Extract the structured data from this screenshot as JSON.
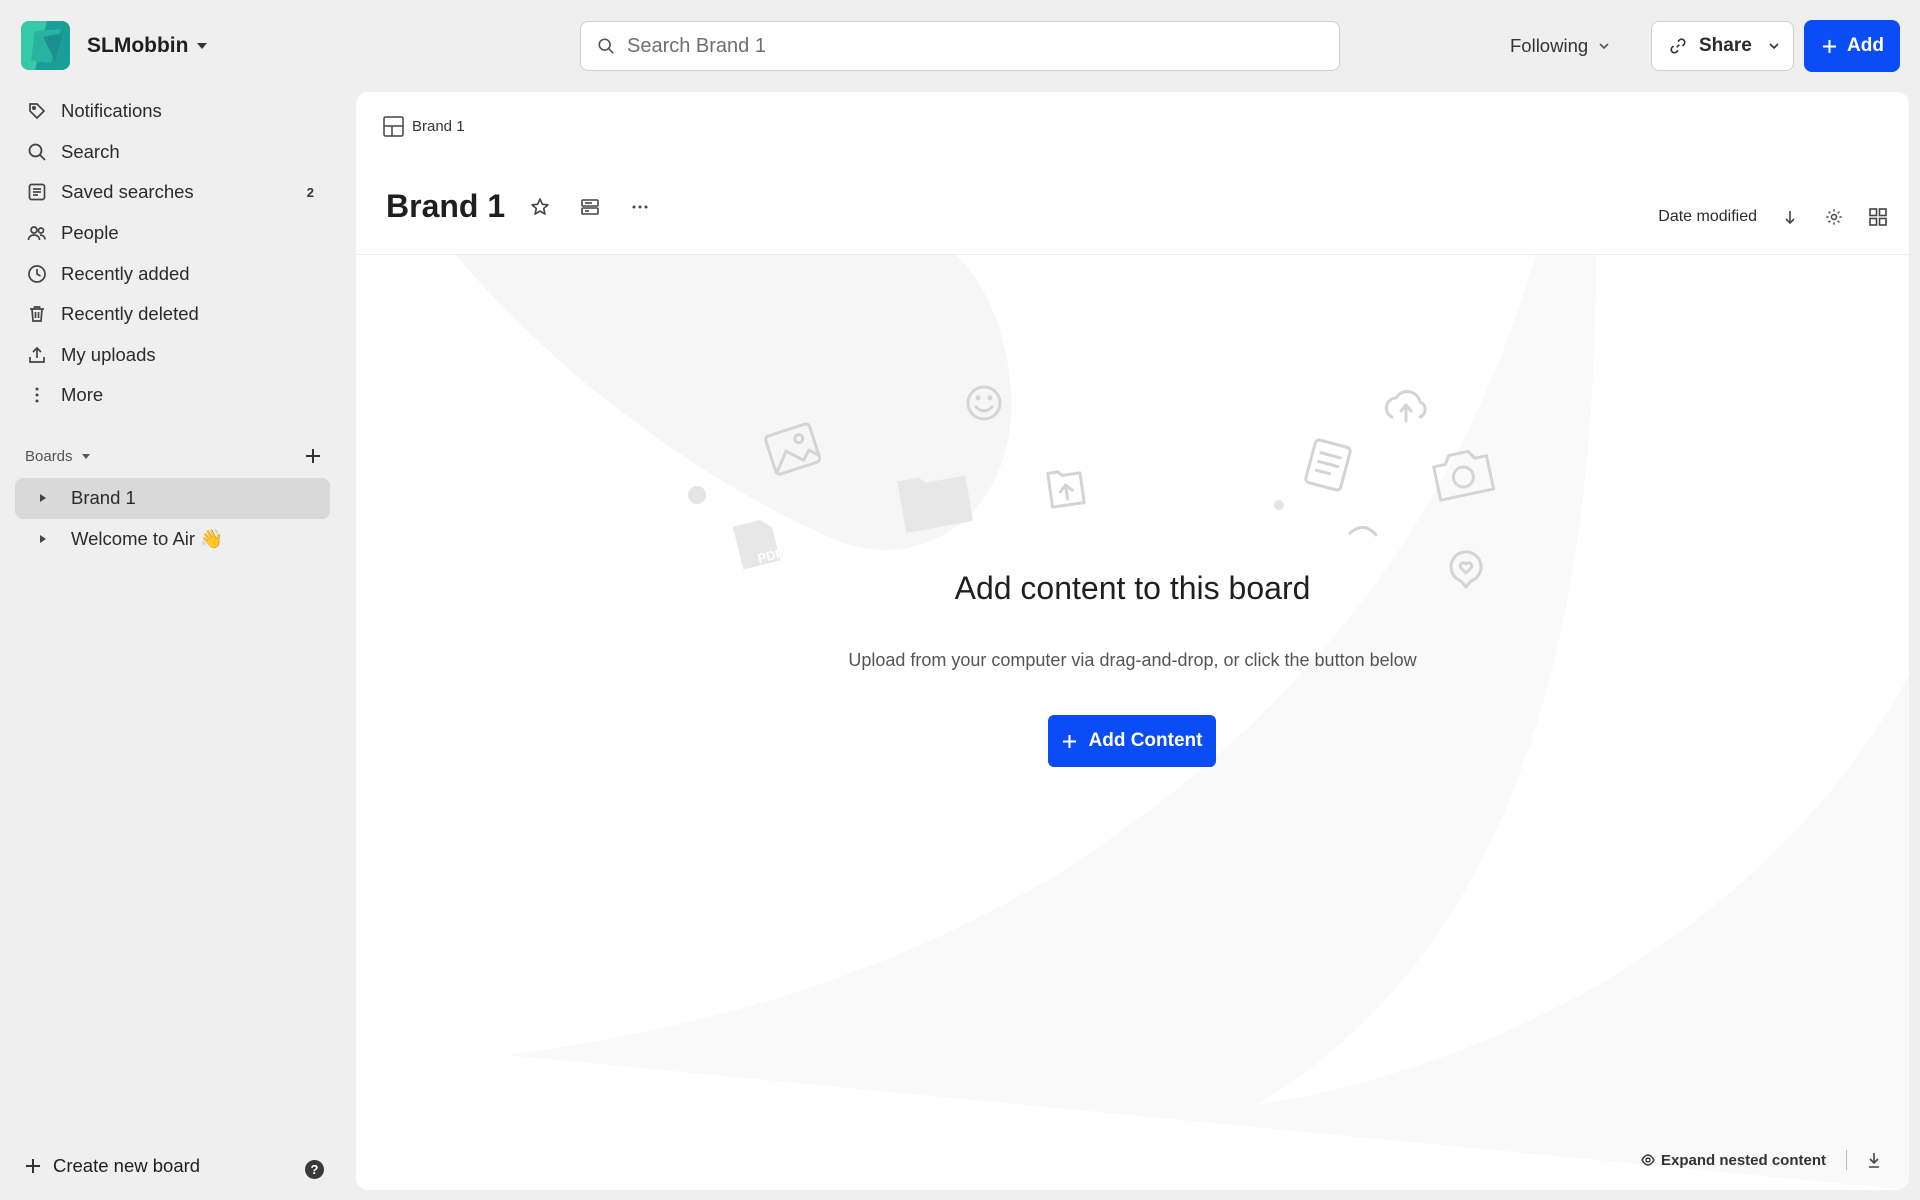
{
  "workspace": {
    "name": "SLMobbin"
  },
  "nav": {
    "items": [
      {
        "label": "Notifications",
        "icon": "tag-icon"
      },
      {
        "label": "Search",
        "icon": "search-icon"
      },
      {
        "label": "Saved searches",
        "icon": "saved-searches-icon",
        "count": "2"
      },
      {
        "label": "People",
        "icon": "people-icon"
      },
      {
        "label": "Recently added",
        "icon": "clock-icon"
      },
      {
        "label": "Recently deleted",
        "icon": "trash-icon"
      },
      {
        "label": "My uploads",
        "icon": "upload-icon"
      },
      {
        "label": "More",
        "icon": "more-vertical-icon"
      }
    ]
  },
  "boards": {
    "label": "Boards",
    "items": [
      {
        "label": "Brand 1",
        "active": true
      },
      {
        "label": "Welcome to Air 👋",
        "active": false
      }
    ],
    "create_label": "Create new board"
  },
  "search": {
    "placeholder": "Search Brand 1"
  },
  "header": {
    "following_label": "Following",
    "share_label": "Share",
    "add_label": "Add"
  },
  "board": {
    "breadcrumb": "Brand 1",
    "title": "Brand 1",
    "sort_label": "Date modified"
  },
  "empty_state": {
    "title": "Add content to this board",
    "subtitle": "Upload from your computer via drag-and-drop, or click the button below",
    "button_label": "Add Content"
  },
  "footer": {
    "expand_label": "Expand nested content"
  },
  "colors": {
    "accent": "#0a4cf5",
    "sidebar_bg": "#efefef",
    "active_board_bg": "#d9d9d9"
  }
}
